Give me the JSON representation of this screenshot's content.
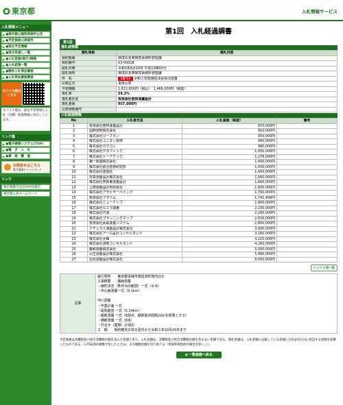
{
  "header": {
    "logo_text": "東京都",
    "subtitle": "入札情報サービス"
  },
  "sidebar": {
    "section1": "入札情報メニュー",
    "menu": [
      "●東京都公報発表案件公告",
      "●予定価格公表案件",
      "●発注予定情報",
      "●発注見通し一覧",
      "●入札実施(執行)情報",
      "●入札結果一覧",
      "●競争入札参加資格",
      "●入札参加資格関係"
    ],
    "mobile_badge": "モバイル版はこちら",
    "mobile_note": "モバイル版は、発注予定情報と入札（見積）経過情報に対応しています。",
    "section2": "リンク集",
    "links2": [
      "●電子調達システム(TOP)",
      "●電　子　入　札",
      "●資　格　審　査"
    ],
    "reissue_label": "お問合せはこちら",
    "reissue_sub": "電子調達チャットボット",
    "section3": "リンク",
    "links3": [
      "東京都電子自治体共同運営",
      "東京都公式ホームページ"
    ]
  },
  "main": {
    "title": "第1回　入札経過調書",
    "tab_label": "第1回",
    "info_section": "落札者情報",
    "info_head": {
      "item": "落札項目",
      "content": "落札内容"
    },
    "info_rows": [
      {
        "label": "契約部署",
        "value": "環境局多摩環境事務所管理課"
      },
      {
        "label": "契約番号",
        "value": "03-00018"
      },
      {
        "label": "開札日時",
        "value": "令和3年6月18日 午前10時00分"
      },
      {
        "label": "開札場所",
        "value": "環境局多摩環境事務所管理課"
      },
      {
        "label": "件　名",
        "badge": "【電子】",
        "value": "令和３年度御岳渓谷現況測量"
      },
      {
        "label": "公表区分",
        "value": "事後公表"
      },
      {
        "label": "予定価格",
        "value": "1,612,600円（税込）　1,466,000円（税抜）"
      },
      {
        "label": "落札率",
        "value": "59.3%"
      },
      {
        "label": "落札者氏名",
        "value": "有限会社若林測量設計"
      },
      {
        "label": "落札金額",
        "value": "957,000円"
      },
      {
        "label": "公表通知番号",
        "value": ""
      }
    ],
    "bid_section": "入札経過情報",
    "bid_head": {
      "no": "No",
      "name": "入札者氏名",
      "amount": "入札金額（税抜）",
      "note": "備考"
    },
    "bids": [
      {
        "no": "1",
        "name": "有限会社若林測量設計",
        "amount": "870,000円"
      },
      {
        "no": "2",
        "name": "国際測地株式会社",
        "amount": "910,000円"
      },
      {
        "no": "3",
        "name": "株式会社ジープラン",
        "amount": "950,000円"
      },
      {
        "no": "4",
        "name": "株式会社ユニオン技術",
        "amount": "960,000円"
      },
      {
        "no": "5",
        "name": "株式会社カワコン",
        "amount": "980,000円"
      },
      {
        "no": "6",
        "name": "株式会社グラフィック",
        "amount": "1,050,000円"
      },
      {
        "no": "7",
        "name": "株式会社トーアテック",
        "amount": "1,278,000円"
      },
      {
        "no": "8",
        "name": "第一航業株式会社",
        "amount": "1,400,000円"
      },
      {
        "no": "9",
        "name": "株式会社総合技術研究所",
        "amount": "1,430,000円"
      },
      {
        "no": "10",
        "name": "株式会社建成社",
        "amount": "1,450,000円"
      },
      {
        "no": "11",
        "name": "日栄測量設計株式会社",
        "amount": "1,560,000円"
      },
      {
        "no": "12",
        "name": "株式会社奈賀東測量設計",
        "amount": "1,600,000円"
      },
      {
        "no": "13",
        "name": "上田測量設計有限会社",
        "amount": "1,600,000円"
      },
      {
        "no": "14",
        "name": "株式会社アサヒサーベイング",
        "amount": "1,700,000円"
      },
      {
        "no": "15",
        "name": "有限会社プライム",
        "amount": "1,741,499円"
      },
      {
        "no": "16",
        "name": "株式会社ニューテップ",
        "amount": "1,800,000円"
      },
      {
        "no": "17",
        "name": "株式会社ＧＩＳ関東",
        "amount": "2,100,000円"
      },
      {
        "no": "18",
        "name": "株式会社巧測",
        "amount": "2,200,000円"
      },
      {
        "no": "19",
        "name": "株式会社プランニングマップ",
        "amount": "2,630,000円"
      },
      {
        "no": "20",
        "name": "有限会社武蔵測量システム",
        "amount": "2,800,000円"
      },
      {
        "no": "21",
        "name": "ナチュラル測量設計株式会社",
        "amount": "3,000,000円"
      },
      {
        "no": "22",
        "name": "株式会社アース設計コンサルタント",
        "amount": "3,160,000円"
      },
      {
        "no": "23",
        "name": "株式会社大輝",
        "amount": "4,220,000円"
      },
      {
        "no": "24",
        "name": "株式会社測地コンサルタント",
        "amount": "4,260,000円"
      },
      {
        "no": "25",
        "name": "藤和測量株式会社",
        "amount": "5,000,000円"
      },
      {
        "no": "26",
        "name": "山王測量設計株式会社",
        "amount": "5,460,000円"
      },
      {
        "no": "27",
        "name": "児島測量設計株式会社",
        "amount": "8,000,000円"
      }
    ],
    "history_button": "ハッシュ値一覧",
    "remarks_label": "記事",
    "remarks_text": "履行場所　　東京都青梅市御岳本町地内ほか\n工事概要　　路線測量\n・線形決定（条件点の観測）一式（８点）\n・中心線測量一式（0.1km）\n\n河川測量\n・作業計画 一式\n・堤防踏査 一式（0.14km）\n・縦断測量 一式（8測点、縦断測点間隔20mを標準とする）\n・横断測量 一式（8本）\n・打合せ（業務）計4回）\n工　期　　契約確定の日の翌日から令和３年10月29日まで",
    "footnote": "予定価格は消費税及び地方消費税の額を含んだ金額であり、入札金額は、消費税及び地方消費税の額を含まない金額である。落札金額は、入札金額に記載している金額に100分の110に相当する金額を加算したものである（１円未満の端数が生じたときは、その端数金額を切り捨てる（単価単価契約の場合を除く。））。",
    "back_button": "◀ 一覧画面へ戻る"
  }
}
